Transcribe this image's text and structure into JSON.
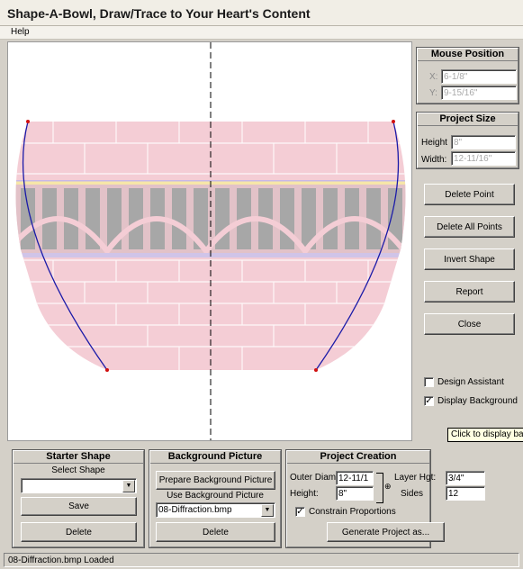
{
  "window": {
    "title": "Shape-A-Bowl, Draw/Trace to Your Heart's Content"
  },
  "menu": {
    "help": "Help"
  },
  "mouse_position": {
    "title": "Mouse Position",
    "x_label": "X:",
    "x_value": "6-1/8\"",
    "y_label": "Y:",
    "y_value": "9-15/16\""
  },
  "project_size": {
    "title": "Project Size",
    "height_label": "Height",
    "height_value": "8\"",
    "width_label": "Width:",
    "width_value": "12-11/16\""
  },
  "actions": {
    "delete_point": "Delete Point",
    "delete_all_points": "Delete All Points",
    "invert_shape": "Invert Shape",
    "report": "Report",
    "close": "Close"
  },
  "options": {
    "design_assistant": {
      "label": "Design Assistant",
      "checked": false
    },
    "display_background": {
      "label": "Display Background",
      "checked": true
    }
  },
  "tooltip": "Click to display bac",
  "starter_shape": {
    "title": "Starter Shape",
    "select_label": "Select Shape",
    "selected": "",
    "save": "Save",
    "delete": "Delete"
  },
  "background_picture": {
    "title": "Background Picture",
    "prepare": "Prepare Background Picture",
    "use_label": "Use Background Picture",
    "selected": "08-Diffraction.bmp",
    "delete": "Delete"
  },
  "project_creation": {
    "title": "Project Creation",
    "outer_diam_label": "Outer Diam.",
    "outer_diam_value": "12-11/1",
    "height_label": "Height:",
    "height_value": "8\"",
    "layer_hgt_label": "Layer Hgt:",
    "layer_hgt_value": "3/4\"",
    "sides_label": "Sides",
    "sides_value": "12",
    "constrain_label": "Constrain Proportions",
    "constrain_checked": true,
    "generate": "Generate Project as..."
  },
  "status": "08-Diffraction.bmp Loaded",
  "colors": {
    "bowl_fill": "#f4cdd5",
    "brick_line": "#ffffff",
    "band_gray": "#a7a7a7",
    "curve": "#1a1aa8",
    "point": "#d01010"
  }
}
